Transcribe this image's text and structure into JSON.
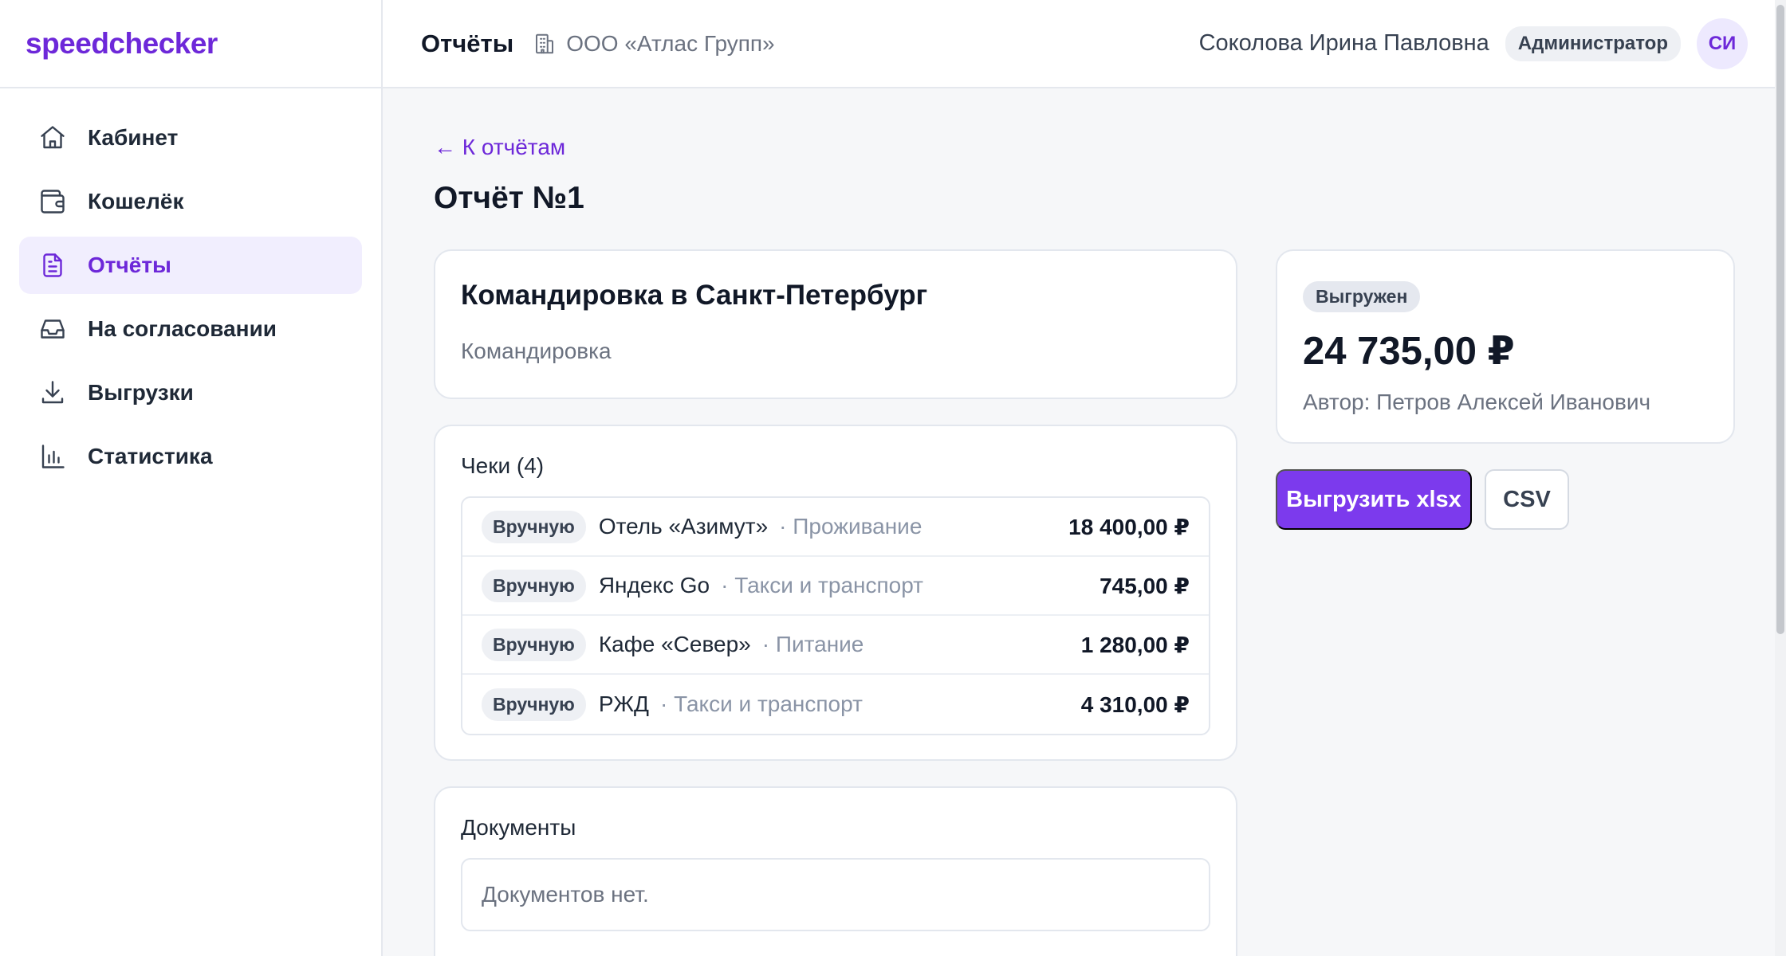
{
  "app": {
    "logo": "speedchecker"
  },
  "sidebar": {
    "items": [
      {
        "label": "Кабинет",
        "icon": "home-icon",
        "active": false
      },
      {
        "label": "Кошелёк",
        "icon": "wallet-icon",
        "active": false
      },
      {
        "label": "Отчёты",
        "icon": "document-icon",
        "active": true
      },
      {
        "label": "На согласовании",
        "icon": "inbox-icon",
        "active": false
      },
      {
        "label": "Выгрузки",
        "icon": "download-icon",
        "active": false
      },
      {
        "label": "Статистика",
        "icon": "bar-chart-icon",
        "active": false
      }
    ]
  },
  "header": {
    "title": "Отчёты",
    "org": "ООО «Атлас Групп»",
    "user_name": "Соколова Ирина Павловна",
    "role": "Администратор",
    "avatar_initials": "СИ"
  },
  "main": {
    "back_link": "← К отчётам",
    "page_title": "Отчёт №1",
    "report": {
      "name": "Командировка в Санкт-Петербург",
      "type": "Командировка"
    },
    "receipts": {
      "title": "Чеки (4)",
      "rows": [
        {
          "source": "Вручную",
          "merchant": "Отель «Азимут»",
          "category": "· Проживание",
          "amount": "18 400,00 ₽"
        },
        {
          "source": "Вручную",
          "merchant": "Яндекс Go",
          "category": "· Такси и транспорт",
          "amount": "745,00 ₽"
        },
        {
          "source": "Вручную",
          "merchant": "Кафе «Север»",
          "category": "· Питание",
          "amount": "1 280,00 ₽"
        },
        {
          "source": "Вручную",
          "merchant": "РЖД",
          "category": "· Такси и транспорт",
          "amount": "4 310,00 ₽"
        }
      ]
    },
    "documents": {
      "title": "Документы",
      "empty": "Документов нет."
    },
    "summary": {
      "status": "Выгружен",
      "total": "24 735,00 ₽",
      "author": "Автор: Петров Алексей Иванович"
    },
    "actions": {
      "xlsx_label": "Выгрузить xlsx",
      "csv_label": "CSV"
    }
  },
  "colors": {
    "accent": "#7c3aed",
    "accent_text": "#6d28d9",
    "accent_bg": "#f1eefe"
  }
}
